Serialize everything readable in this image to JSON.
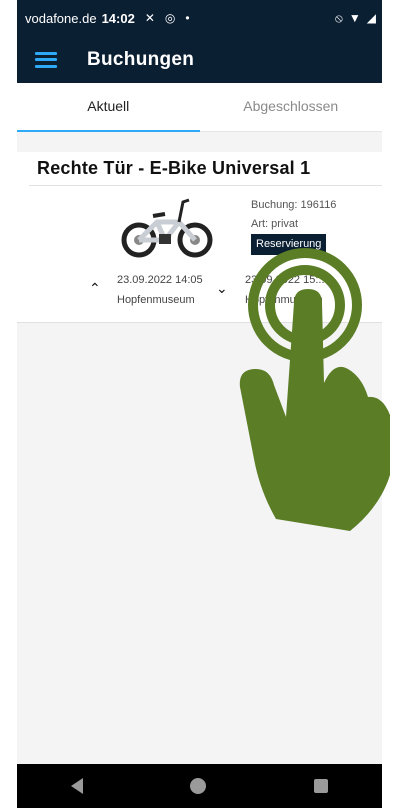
{
  "status_bar": {
    "carrier": "vodafone.de",
    "time": "14:02",
    "icons": [
      "x-icon",
      "location-icon",
      "dot-icon",
      "mute-icon",
      "wifi-icon",
      "signal-icon"
    ]
  },
  "app_bar": {
    "title": "Buchungen"
  },
  "tabs": [
    {
      "label": "Aktuell",
      "active": true
    },
    {
      "label": "Abgeschlossen",
      "active": false
    }
  ],
  "booking": {
    "title": "Rechte Tür - E-Bike Universal 1",
    "booking_label": "Buchung: 196116",
    "type_label": "Art: privat",
    "status": "Reservierung",
    "start": {
      "datetime": "23.09.2022 14:05",
      "location": "Hopfenmuseum"
    },
    "end": {
      "datetime": "23.09.2022 15:...",
      "location": "Hopfenmuseum"
    }
  },
  "nav": {
    "icons": [
      "back-icon",
      "home-icon",
      "recent-apps-icon"
    ]
  },
  "colors": {
    "dark_navy": "#0b1f33",
    "accent_blue": "#2ea9f5",
    "hand_green": "#5a7d25"
  }
}
